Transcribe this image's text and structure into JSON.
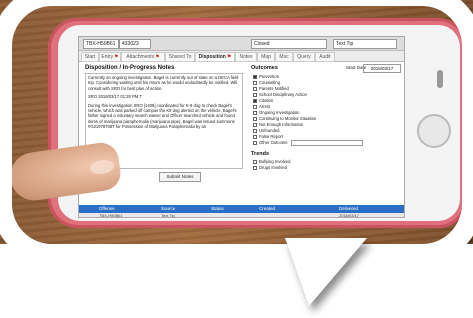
{
  "topbar": {
    "field1": "TBX-H50B61",
    "field2": "433023",
    "status": "Closed",
    "type": "Text Tip"
  },
  "tabs": [
    {
      "label": "Start",
      "flag": false
    },
    {
      "label": "Entry",
      "flag": true
    },
    {
      "label": "Attachments",
      "flag": true
    },
    {
      "label": "Shared To",
      "flag": false
    },
    {
      "label": "Disposition",
      "flag": true
    },
    {
      "label": "Notes",
      "flag": false
    },
    {
      "label": "Map",
      "flag": false
    },
    {
      "label": "Msc",
      "flag": false
    },
    {
      "label": "Query",
      "flag": false
    },
    {
      "label": "Audit",
      "flag": false
    }
  ],
  "left": {
    "title": "Disposition / In-Progress Notes",
    "note1": "Currently an ongoing investigation. Bagel is currently out of state on a DECA field trip. Considering waiting until his return as he would undoubtedly be notified. Will consult with SRO for best plan of action.",
    "note2": "SRO 2016/03/17 01:26 PM T",
    "note3": "During this investigation SRO [1408] coordinated for K-9 dog to check Bagel's vehicle, which was parked off campus the K9 dog alerted on the vehicle. Bagel's father signed a voluntary search waiver and Officer searched vehicle and found items of marijuana paraphernalia (marijuana pipe). Bagel was issued summons #G21978708T for Possession of Marijuana Paraphernalia by an",
    "submit": "Submit Notes"
  },
  "right": {
    "outcomes_label": "Outcomes",
    "start_label": "Start Date",
    "start_value": "2016/03/17",
    "outcomes": [
      {
        "label": "Prevention",
        "checked": true
      },
      {
        "label": "Counseling",
        "checked": false
      },
      {
        "label": "Parents Notified",
        "checked": false
      },
      {
        "label": "School Disciplinary Action",
        "checked": false
      },
      {
        "label": "Citation",
        "checked": true
      },
      {
        "label": "Arrest",
        "checked": false
      },
      {
        "label": "Ongoing Investigation",
        "checked": false
      },
      {
        "label": "Continuing to Monitor Situation",
        "checked": false
      },
      {
        "label": "Not Enough Information",
        "checked": false
      },
      {
        "label": "Unfounded",
        "checked": false
      },
      {
        "label": "False Report",
        "checked": false
      },
      {
        "label": "Other Outcome",
        "checked": false
      }
    ],
    "trends_label": "Trends",
    "trends": [
      {
        "label": "Bullying Involved",
        "checked": false
      },
      {
        "label": "Drugs Involved",
        "checked": false
      }
    ]
  },
  "grid": {
    "headers": [
      "Offense",
      "Source",
      "Status",
      "Created",
      "Delivered"
    ],
    "row": [
      "TBX-H50B61",
      "Text Tip",
      "",
      "",
      "2016/03/17"
    ]
  }
}
